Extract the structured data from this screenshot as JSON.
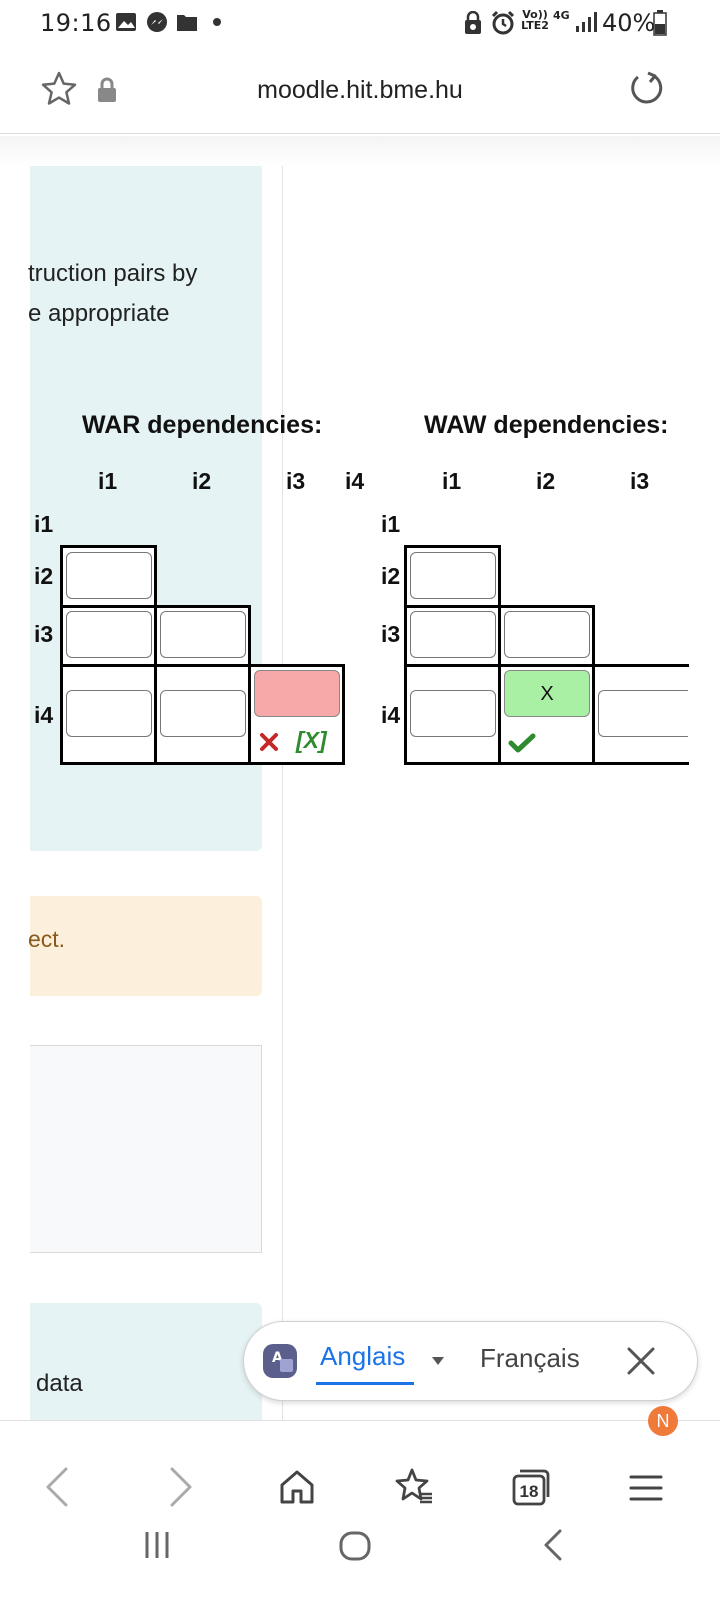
{
  "status_bar": {
    "time": "19:16",
    "net_top": "Vo))",
    "net_bottom": "LTE2",
    "net_type": "4G",
    "battery": "40%"
  },
  "browser": {
    "url": "moodle.hit.bme.hu",
    "tab_count": "18",
    "menu_badge": "N"
  },
  "question": {
    "line1": "truction pairs by",
    "line2": "e appropriate"
  },
  "war": {
    "title": "WAR dependencies:",
    "cols": [
      "i1",
      "i2",
      "i3",
      "i4"
    ],
    "rows": [
      "i1",
      "i2",
      "i3",
      "i4"
    ],
    "i4_i3_value": "",
    "i4_i3_correct": "[X]"
  },
  "waw": {
    "title": "WAW dependencies:",
    "cols": [
      "i1",
      "i2",
      "i3"
    ],
    "rows": [
      "i1",
      "i2",
      "i3",
      "i4"
    ],
    "i4_i2_value": "X"
  },
  "feedback": {
    "text": "ect."
  },
  "next_question": {
    "text": "data"
  },
  "translate": {
    "source_lang": "Anglais",
    "target_lang": "Français"
  },
  "colors": {
    "accent": "#1a73e8",
    "correct": "#2e8b2e",
    "incorrect": "#c62828",
    "panel": "#e6f3f4",
    "feedback_bg": "#fcefdc"
  }
}
